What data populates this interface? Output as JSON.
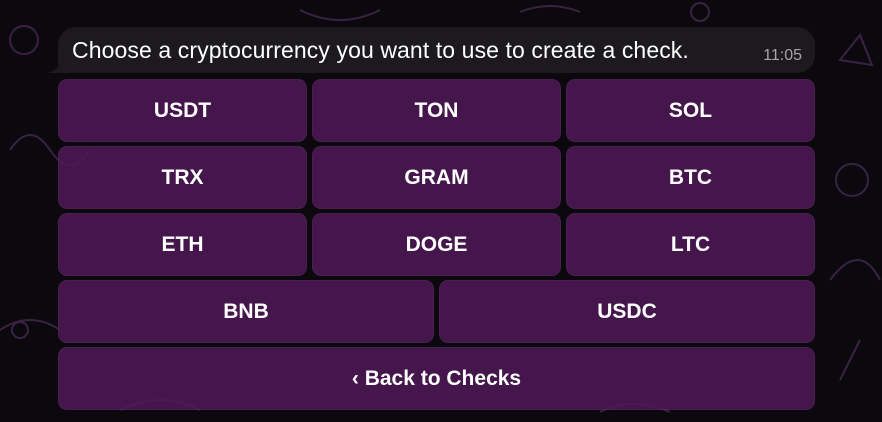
{
  "message": {
    "text": "Choose a cryptocurrency you want to use to create a check.",
    "time": "11:05"
  },
  "keyboard": {
    "rows": [
      [
        "USDT",
        "TON",
        "SOL"
      ],
      [
        "TRX",
        "GRAM",
        "BTC"
      ],
      [
        "ETH",
        "DOGE",
        "LTC"
      ],
      [
        "BNB",
        "USDC"
      ]
    ],
    "back_label": "‹ Back to Checks"
  },
  "colors": {
    "button_bg": "#4e1856",
    "bubble_bg": "#1c1a1e",
    "doodle_stroke": "#3a2244"
  }
}
